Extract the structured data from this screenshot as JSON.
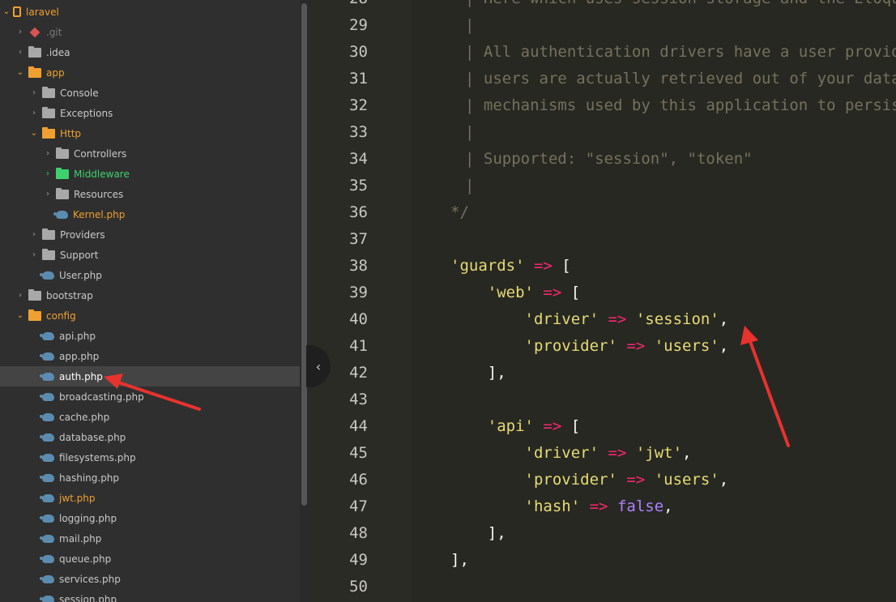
{
  "sidebar": {
    "items": [
      {
        "label": "laravel",
        "indent": 0,
        "arrow": "open",
        "icon": "repo",
        "color": "orange"
      },
      {
        "label": ".git",
        "indent": 1,
        "arrow": "closed",
        "icon": "git",
        "color": "dim"
      },
      {
        "label": ".idea",
        "indent": 1,
        "arrow": "closed",
        "icon": "folder",
        "color": "normal"
      },
      {
        "label": "app",
        "indent": 1,
        "arrow": "open",
        "icon": "folder-orange",
        "color": "orange"
      },
      {
        "label": "Console",
        "indent": 2,
        "arrow": "closed",
        "icon": "folder",
        "color": "normal"
      },
      {
        "label": "Exceptions",
        "indent": 2,
        "arrow": "closed",
        "icon": "folder",
        "color": "normal"
      },
      {
        "label": "Http",
        "indent": 2,
        "arrow": "open",
        "icon": "folder-orange",
        "color": "orange"
      },
      {
        "label": "Controllers",
        "indent": 3,
        "arrow": "closed",
        "icon": "folder",
        "color": "normal"
      },
      {
        "label": "Middleware",
        "indent": 3,
        "arrow": "green",
        "icon": "folder-green",
        "color": "green"
      },
      {
        "label": "Resources",
        "indent": 3,
        "arrow": "closed",
        "icon": "folder",
        "color": "normal"
      },
      {
        "label": "Kernel.php",
        "indent": 3,
        "arrow": "none",
        "icon": "php",
        "color": "orange"
      },
      {
        "label": "Providers",
        "indent": 2,
        "arrow": "closed",
        "icon": "folder",
        "color": "normal"
      },
      {
        "label": "Support",
        "indent": 2,
        "arrow": "closed",
        "icon": "folder",
        "color": "normal"
      },
      {
        "label": "User.php",
        "indent": 2,
        "arrow": "none",
        "icon": "php",
        "color": "normal"
      },
      {
        "label": "bootstrap",
        "indent": 1,
        "arrow": "closed",
        "icon": "folder",
        "color": "normal"
      },
      {
        "label": "config",
        "indent": 1,
        "arrow": "open",
        "icon": "folder-orange",
        "color": "orange"
      },
      {
        "label": "api.php",
        "indent": 2,
        "arrow": "none",
        "icon": "php",
        "color": "normal"
      },
      {
        "label": "app.php",
        "indent": 2,
        "arrow": "none",
        "icon": "php",
        "color": "normal"
      },
      {
        "label": "auth.php",
        "indent": 2,
        "arrow": "none",
        "icon": "php",
        "color": "white",
        "selected": true
      },
      {
        "label": "broadcasting.php",
        "indent": 2,
        "arrow": "none",
        "icon": "php",
        "color": "normal"
      },
      {
        "label": "cache.php",
        "indent": 2,
        "arrow": "none",
        "icon": "php",
        "color": "normal"
      },
      {
        "label": "database.php",
        "indent": 2,
        "arrow": "none",
        "icon": "php",
        "color": "normal"
      },
      {
        "label": "filesystems.php",
        "indent": 2,
        "arrow": "none",
        "icon": "php",
        "color": "normal"
      },
      {
        "label": "hashing.php",
        "indent": 2,
        "arrow": "none",
        "icon": "php",
        "color": "normal"
      },
      {
        "label": "jwt.php",
        "indent": 2,
        "arrow": "none",
        "icon": "php",
        "color": "orange"
      },
      {
        "label": "logging.php",
        "indent": 2,
        "arrow": "none",
        "icon": "php",
        "color": "normal"
      },
      {
        "label": "mail.php",
        "indent": 2,
        "arrow": "none",
        "icon": "php",
        "color": "normal"
      },
      {
        "label": "queue.php",
        "indent": 2,
        "arrow": "none",
        "icon": "php",
        "color": "normal"
      },
      {
        "label": "services.php",
        "indent": 2,
        "arrow": "none",
        "icon": "php",
        "color": "normal"
      },
      {
        "label": "session.php",
        "indent": 2,
        "arrow": "none",
        "icon": "php",
        "color": "normal"
      }
    ]
  },
  "collapse_toggle": {
    "glyph": "‹"
  },
  "editor": {
    "first_line_partial": "28",
    "lines": [
      {
        "n": "28",
        "tokens": [
          {
            "t": "| Here which uses session storage and the Eloquent",
            "c": "cm"
          }
        ]
      },
      {
        "n": "29",
        "tokens": [
          {
            "t": "|",
            "c": "cm"
          }
        ]
      },
      {
        "n": "30",
        "tokens": [
          {
            "t": "| All authentication drivers have a user provider",
            "c": "cm"
          }
        ]
      },
      {
        "n": "31",
        "tokens": [
          {
            "t": "| users are actually retrieved out of your database",
            "c": "cm"
          }
        ]
      },
      {
        "n": "32",
        "tokens": [
          {
            "t": "| mechanisms used by this application to persist",
            "c": "cm"
          }
        ]
      },
      {
        "n": "33",
        "tokens": [
          {
            "t": "|",
            "c": "cm"
          }
        ]
      },
      {
        "n": "34",
        "tokens": [
          {
            "t": "| Supported: \"session\", \"token\"",
            "c": "cm"
          }
        ]
      },
      {
        "n": "35",
        "tokens": [
          {
            "t": "|",
            "c": "cm"
          }
        ]
      },
      {
        "n": "36",
        "tokens": [
          {
            "t": "*/",
            "c": "cm"
          }
        ]
      },
      {
        "n": "37",
        "tokens": []
      },
      {
        "n": "38",
        "tokens": [
          {
            "t": "'guards'",
            "c": "str"
          },
          {
            "t": " ",
            "c": "pn"
          },
          {
            "t": "=>",
            "c": "op"
          },
          {
            "t": " [",
            "c": "pn"
          }
        ]
      },
      {
        "n": "39",
        "tokens": [
          {
            "t": "    ",
            "c": "pn"
          },
          {
            "t": "'web'",
            "c": "str"
          },
          {
            "t": " ",
            "c": "pn"
          },
          {
            "t": "=>",
            "c": "op"
          },
          {
            "t": " [",
            "c": "pn"
          }
        ]
      },
      {
        "n": "40",
        "tokens": [
          {
            "t": "        ",
            "c": "pn"
          },
          {
            "t": "'driver'",
            "c": "str"
          },
          {
            "t": " ",
            "c": "pn"
          },
          {
            "t": "=>",
            "c": "op"
          },
          {
            "t": " ",
            "c": "pn"
          },
          {
            "t": "'session'",
            "c": "str"
          },
          {
            "t": ",",
            "c": "pn"
          }
        ]
      },
      {
        "n": "41",
        "tokens": [
          {
            "t": "        ",
            "c": "pn"
          },
          {
            "t": "'provider'",
            "c": "str"
          },
          {
            "t": " ",
            "c": "pn"
          },
          {
            "t": "=>",
            "c": "op"
          },
          {
            "t": " ",
            "c": "pn"
          },
          {
            "t": "'users'",
            "c": "str"
          },
          {
            "t": ",",
            "c": "pn"
          }
        ]
      },
      {
        "n": "42",
        "tokens": [
          {
            "t": "    ],",
            "c": "pn"
          }
        ]
      },
      {
        "n": "43",
        "tokens": []
      },
      {
        "n": "44",
        "tokens": [
          {
            "t": "    ",
            "c": "pn"
          },
          {
            "t": "'api'",
            "c": "str"
          },
          {
            "t": " ",
            "c": "pn"
          },
          {
            "t": "=>",
            "c": "op"
          },
          {
            "t": " [",
            "c": "pn"
          }
        ]
      },
      {
        "n": "45",
        "tokens": [
          {
            "t": "        ",
            "c": "pn"
          },
          {
            "t": "'driver'",
            "c": "str"
          },
          {
            "t": " ",
            "c": "pn"
          },
          {
            "t": "=>",
            "c": "op"
          },
          {
            "t": " ",
            "c": "pn"
          },
          {
            "t": "'jwt'",
            "c": "str"
          },
          {
            "t": ",",
            "c": "pn"
          }
        ]
      },
      {
        "n": "46",
        "tokens": [
          {
            "t": "        ",
            "c": "pn"
          },
          {
            "t": "'provider'",
            "c": "str"
          },
          {
            "t": " ",
            "c": "pn"
          },
          {
            "t": "=>",
            "c": "op"
          },
          {
            "t": " ",
            "c": "pn"
          },
          {
            "t": "'users'",
            "c": "str"
          },
          {
            "t": ",",
            "c": "pn"
          }
        ]
      },
      {
        "n": "47",
        "tokens": [
          {
            "t": "        ",
            "c": "pn"
          },
          {
            "t": "'hash'",
            "c": "str"
          },
          {
            "t": " ",
            "c": "pn"
          },
          {
            "t": "=>",
            "c": "op"
          },
          {
            "t": " ",
            "c": "pn"
          },
          {
            "t": "false",
            "c": "kw"
          },
          {
            "t": ",",
            "c": "pn"
          }
        ]
      },
      {
        "n": "48",
        "tokens": [
          {
            "t": "    ],",
            "c": "pn"
          }
        ]
      },
      {
        "n": "49",
        "tokens": [
          {
            "t": "],",
            "c": "pn"
          }
        ]
      },
      {
        "n": "50",
        "tokens": []
      }
    ]
  },
  "colors": {
    "sidebar_bg": "#2f2f2f",
    "editor_bg": "#272822",
    "accent_orange": "#f0a030",
    "accent_green": "#3dd16e",
    "arrow_red": "#e8322e"
  }
}
